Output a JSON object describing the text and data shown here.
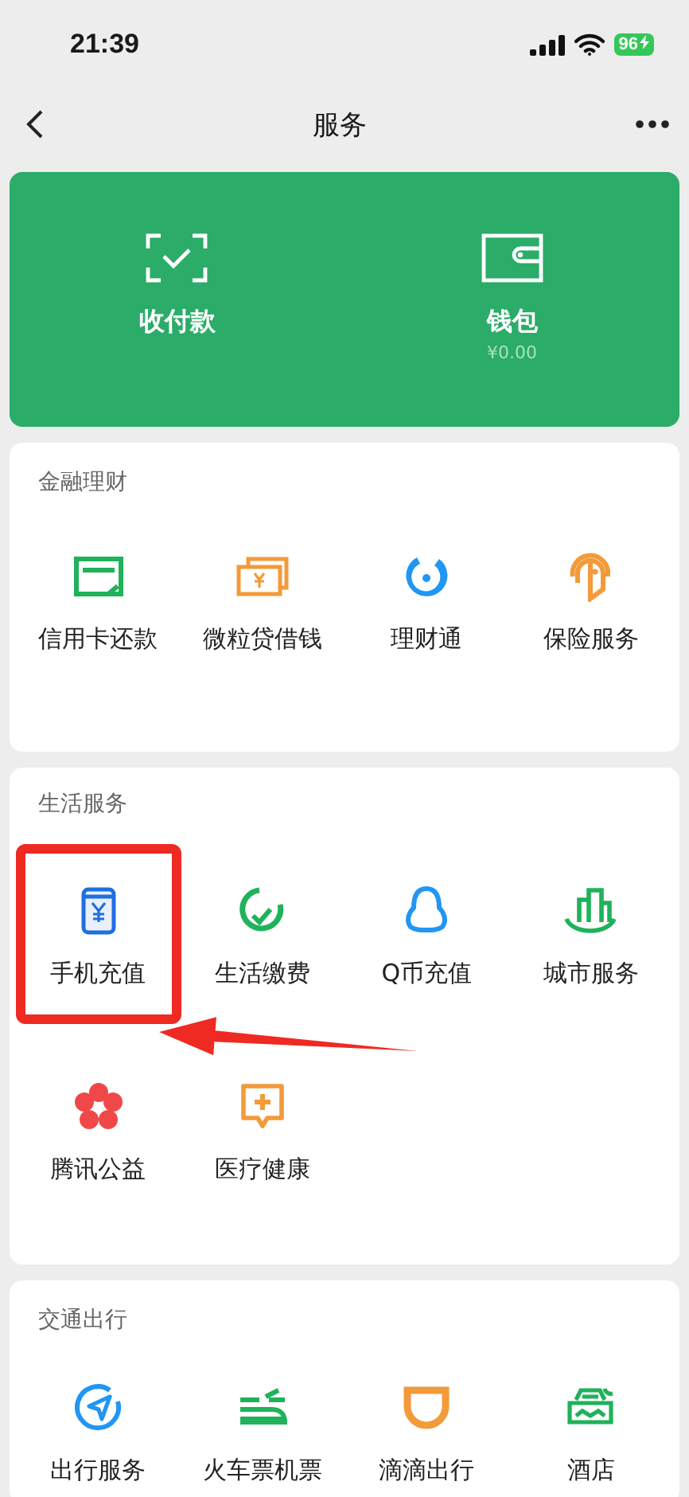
{
  "status_bar": {
    "time": "21:39",
    "battery": "96"
  },
  "nav": {
    "title": "服务"
  },
  "wallet_card": {
    "items": [
      {
        "label": "收付款"
      },
      {
        "label": "钱包",
        "amount": "¥0.00"
      }
    ]
  },
  "sections": [
    {
      "title": "金融理财",
      "items": [
        {
          "label": "信用卡还款",
          "highlighted": false
        },
        {
          "label": "微粒贷借钱",
          "highlighted": false
        },
        {
          "label": "理财通",
          "highlighted": false
        },
        {
          "label": "保险服务",
          "highlighted": false
        }
      ]
    },
    {
      "title": "生活服务",
      "items": [
        {
          "label": "手机充值",
          "highlighted": true
        },
        {
          "label": "生活缴费",
          "highlighted": false
        },
        {
          "label": "Q币充值",
          "highlighted": false
        },
        {
          "label": "城市服务",
          "highlighted": false
        },
        {
          "label": "腾讯公益",
          "highlighted": false
        },
        {
          "label": "医疗健康",
          "highlighted": false
        }
      ]
    },
    {
      "title": "交通出行",
      "items": [
        {
          "label": "出行服务",
          "highlighted": false
        },
        {
          "label": "火车票机票",
          "highlighted": false
        },
        {
          "label": "滴滴出行",
          "highlighted": false
        },
        {
          "label": "酒店",
          "highlighted": false
        }
      ]
    }
  ]
}
